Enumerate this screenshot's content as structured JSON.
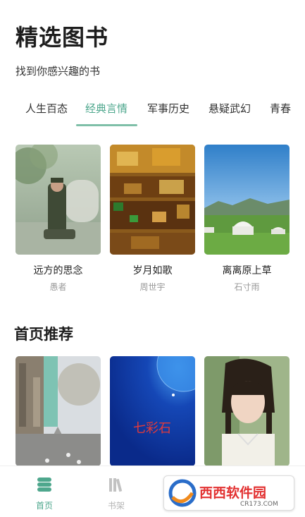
{
  "header": {
    "title": "精选图书",
    "subtitle": "找到你感兴趣的书"
  },
  "tabs": [
    {
      "label": "人生百态",
      "active": false
    },
    {
      "label": "经典言情",
      "active": true
    },
    {
      "label": "军事历史",
      "active": false
    },
    {
      "label": "悬疑武幻",
      "active": false
    },
    {
      "label": "青春",
      "active": false
    }
  ],
  "featured_books": [
    {
      "title": "远方的思念",
      "author": "愚者"
    },
    {
      "title": "岁月如歌",
      "author": "周世宇"
    },
    {
      "title": "离离原上草",
      "author": "石寸雨"
    }
  ],
  "recommend": {
    "title": "首页推荐",
    "books": [
      {
        "cover_text": ""
      },
      {
        "cover_text": "七彩石"
      },
      {
        "cover_text": ""
      }
    ]
  },
  "bottom_nav": [
    {
      "label": "首页",
      "active": true,
      "icon": "home-icon"
    },
    {
      "label": "书架",
      "active": false,
      "icon": "bookshelf-icon"
    }
  ],
  "watermark": {
    "text": "西西软件园",
    "url": "CR173.COM"
  },
  "colors": {
    "accent": "#4ea78d",
    "inactive": "#b5b5b5"
  }
}
